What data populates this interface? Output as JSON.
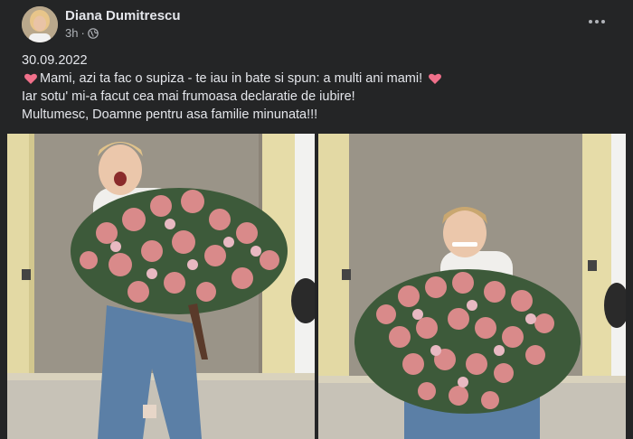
{
  "post": {
    "author_name": "Diana Dumitrescu",
    "time": "3h",
    "privacy_icon": "globe-icon",
    "more_icon": "more-horizontal-icon",
    "date_line": "30.09.2022",
    "line1": "Mami, azi ta fac o supiza - te iau in bate si spun: a multi ani mami!",
    "line2": "Iar sotu' mi-a facut cea mai frumoasa declaratie de iubire!",
    "line3": "Multumesc, Doamne pentru asa familie minunata!!!",
    "heart_emoji": "heart-emoji",
    "photos": [
      {
        "name": "photo-left",
        "subject": "woman-holding-bouquet"
      },
      {
        "name": "photo-right",
        "subject": "woman-holding-bouquet"
      }
    ]
  },
  "colors": {
    "background": "#242526",
    "text_primary": "#e4e6eb",
    "text_secondary": "#b0b3b8",
    "heart": "#f0708a"
  }
}
